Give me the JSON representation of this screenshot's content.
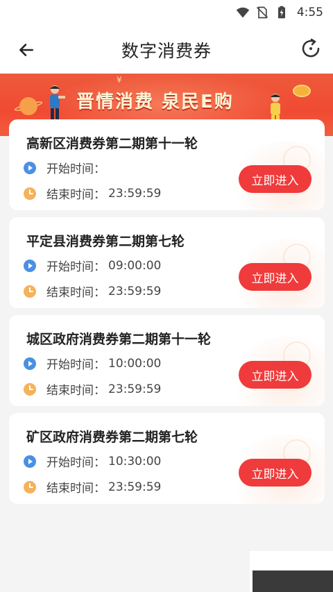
{
  "status_bar": {
    "time": "4:55",
    "icons": [
      "wifi-icon",
      "no-sim-icon",
      "battery-charging-icon"
    ]
  },
  "app_bar": {
    "title": "数字消费券",
    "back_icon": "arrow-left-icon",
    "refresh_icon": "refresh-icon"
  },
  "banner": {
    "text": "晋情消费 泉民E购"
  },
  "common": {
    "start_label": "开始时间：",
    "end_label": "结束时间：",
    "enter_label": "立即进入",
    "start_icon": "play-circle-icon",
    "end_icon": "clock-icon"
  },
  "colors": {
    "accent": "#ef3b3b",
    "start_icon": "#4a90e2",
    "end_icon": "#f5b25c",
    "banner": "#f04a32"
  },
  "cards": [
    {
      "title": "高新区消费券第二期第十一轮",
      "start_value": "",
      "end_value": "23:59:59"
    },
    {
      "title": "平定县消费券第二期第七轮",
      "start_value": "09:00:00",
      "end_value": "23:59:59"
    },
    {
      "title": "城区政府消费券第二期第十一轮",
      "start_value": "10:00:00",
      "end_value": "23:59:59"
    },
    {
      "title": "矿区政府消费券第二期第七轮",
      "start_value": "10:30:00",
      "end_value": "23:59:59"
    }
  ]
}
